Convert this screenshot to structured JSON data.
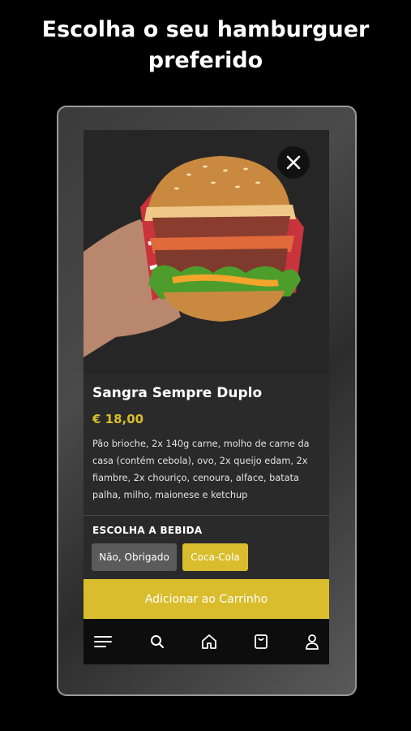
{
  "headline": {
    "line1": "Escolha o seu hamburguer",
    "line2": "preferido"
  },
  "product": {
    "name": "Sangra Sempre Duplo",
    "price": "€ 18,00",
    "description": "Pão brioche, 2x 140g carne, molho de carne da casa (contém cebola), ovo, 2x queijo edam, 2x fiambre, 2x chouriço, cenoura, alface, batata palha, milho, maionese e ketchup"
  },
  "drink": {
    "label": "ESCOLHA A BEBIDA",
    "options": [
      "Não, Obrigado",
      "Coca-Cola"
    ],
    "selected": "Coca-Cola"
  },
  "cart": {
    "add_label": "Adicionar ao Carrinho"
  },
  "nav": {
    "icons": [
      "menu-icon",
      "search-icon",
      "home-icon",
      "bag-icon",
      "profile-icon"
    ]
  },
  "colors": {
    "accent": "#d9bd2c",
    "screen_bg": "#2a2a2a",
    "nav_bg": "#0d0d0d"
  }
}
